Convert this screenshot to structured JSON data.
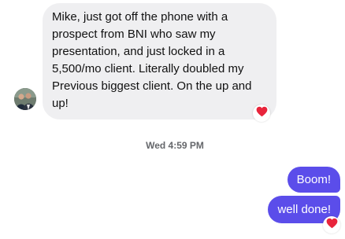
{
  "conversation": {
    "incoming": {
      "text": "Mike, just got off the phone with a prospect from BNI who saw my presentation, and just locked in a 5,500/mo client. Literally doubled my Previous biggest client. On the up and up!",
      "reaction": "heart-icon"
    },
    "timestamp": "Wed 4:59 PM",
    "outgoing": [
      {
        "text": "Boom!"
      },
      {
        "text": "well done!",
        "reaction": "heart-icon"
      }
    ]
  },
  "colors": {
    "incoming_bubble": "#efeff1",
    "outgoing_bubble": "#5b4dea",
    "reaction_heart": "#e8243b",
    "timestamp": "#65676b"
  }
}
